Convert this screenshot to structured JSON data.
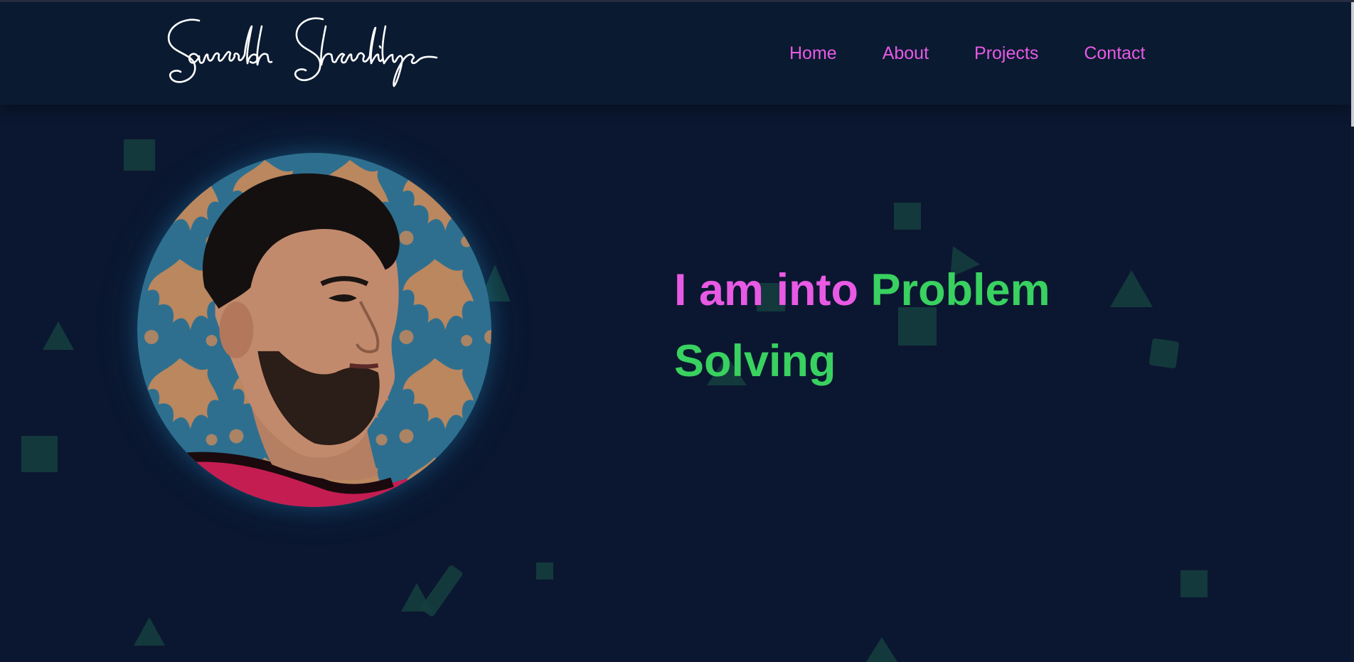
{
  "brand": {
    "logo_text": "Saurabh Shandilya"
  },
  "nav": {
    "items": [
      {
        "label": "Home"
      },
      {
        "label": "About"
      },
      {
        "label": "Projects"
      },
      {
        "label": "Contact"
      }
    ]
  },
  "hero": {
    "headline_prefix": "I am into ",
    "headline_highlight": "Problem Solving",
    "avatar_alt": "Profile photo"
  },
  "colors": {
    "background": "#0b1730",
    "navbar": "#0a1a31",
    "accent_pink": "#e85ae4",
    "accent_green": "#39d160",
    "shape": "#15403e"
  }
}
